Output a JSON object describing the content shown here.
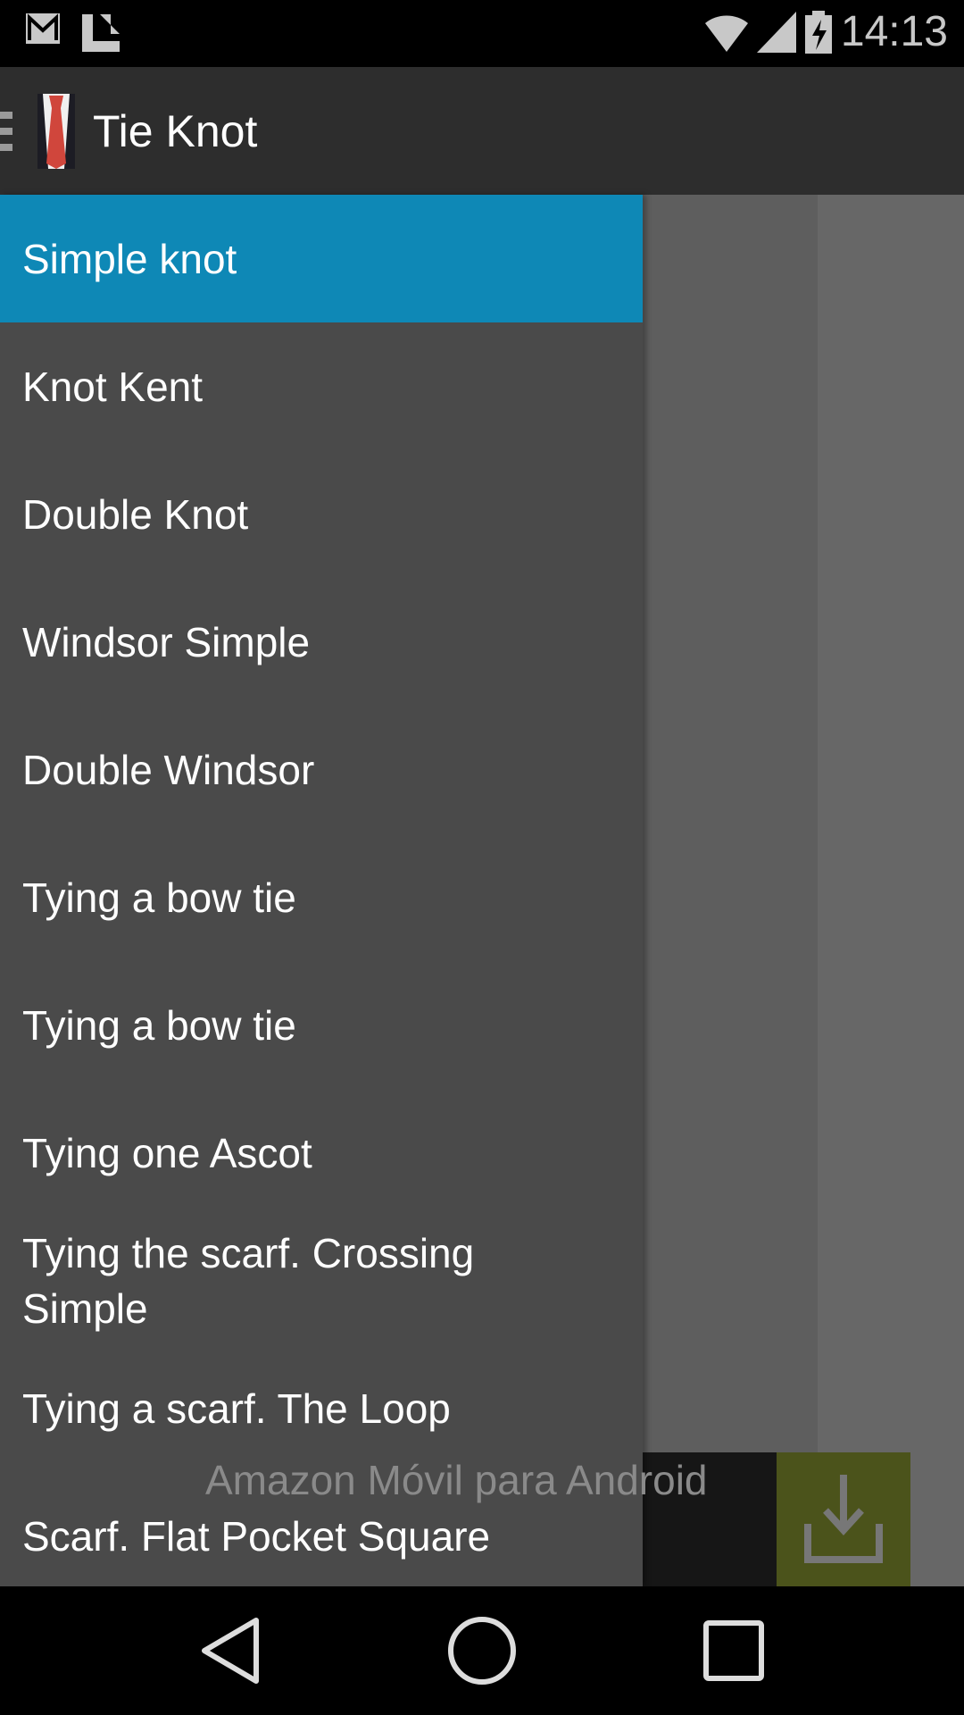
{
  "status_bar": {
    "time": "14:13",
    "icons": [
      "gmail-icon",
      "notification-icon",
      "wifi-icon",
      "signal-icon",
      "battery-charging-icon"
    ]
  },
  "app_bar": {
    "title": "Tie Knot",
    "icon": "tie-logo"
  },
  "drawer": {
    "items": [
      {
        "label": "Simple knot",
        "selected": true
      },
      {
        "label": "Knot Kent"
      },
      {
        "label": "Double Knot"
      },
      {
        "label": "Windsor Simple"
      },
      {
        "label": "Double Windsor"
      },
      {
        "label": "Tying a bow tie"
      },
      {
        "label": "Tying a bow tie"
      },
      {
        "label": "Tying one Ascot"
      },
      {
        "label": "Tying the scarf. Crossing Simple"
      },
      {
        "label": "Tying a scarf. The Loop"
      },
      {
        "label": "Scarf. Flat Pocket Square"
      }
    ],
    "accent": "#0e88b6"
  },
  "ad": {
    "brand": "amazon",
    "text": "Amazon Móvil para Android",
    "button_color": "#4b531b"
  },
  "nav_bar": {
    "buttons": [
      "back",
      "home",
      "recents"
    ]
  }
}
